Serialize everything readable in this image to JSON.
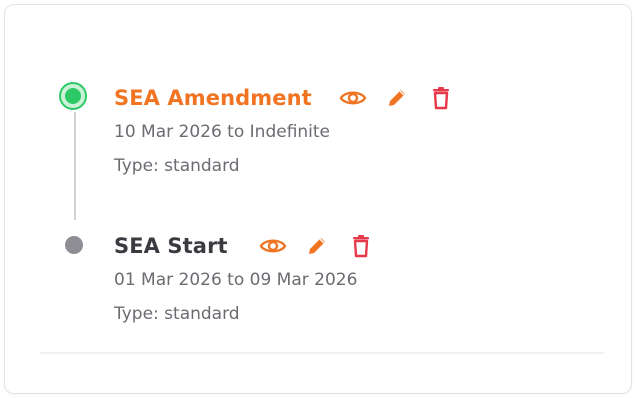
{
  "timeline": {
    "entries": [
      {
        "title": "SEA Amendment",
        "date_range": "10 Mar 2026 to Indefinite",
        "type_label": "Type: standard",
        "status": "active"
      },
      {
        "title": "SEA Start",
        "date_range": "01 Mar 2026 to 09 Mar 2026",
        "type_label": "Type: standard",
        "status": "inactive"
      }
    ]
  },
  "icons": {
    "view": "eye-icon",
    "edit": "pencil-icon",
    "delete": "trash-icon"
  },
  "colors": {
    "active_title": "#f07422",
    "action_view_edit": "#f07422",
    "action_delete": "#e8394a",
    "active_dot": "#2ec866",
    "inactive_dot": "#8e8e94",
    "inactive_title": "#3a3a40",
    "meta_text": "#6b6b72"
  }
}
